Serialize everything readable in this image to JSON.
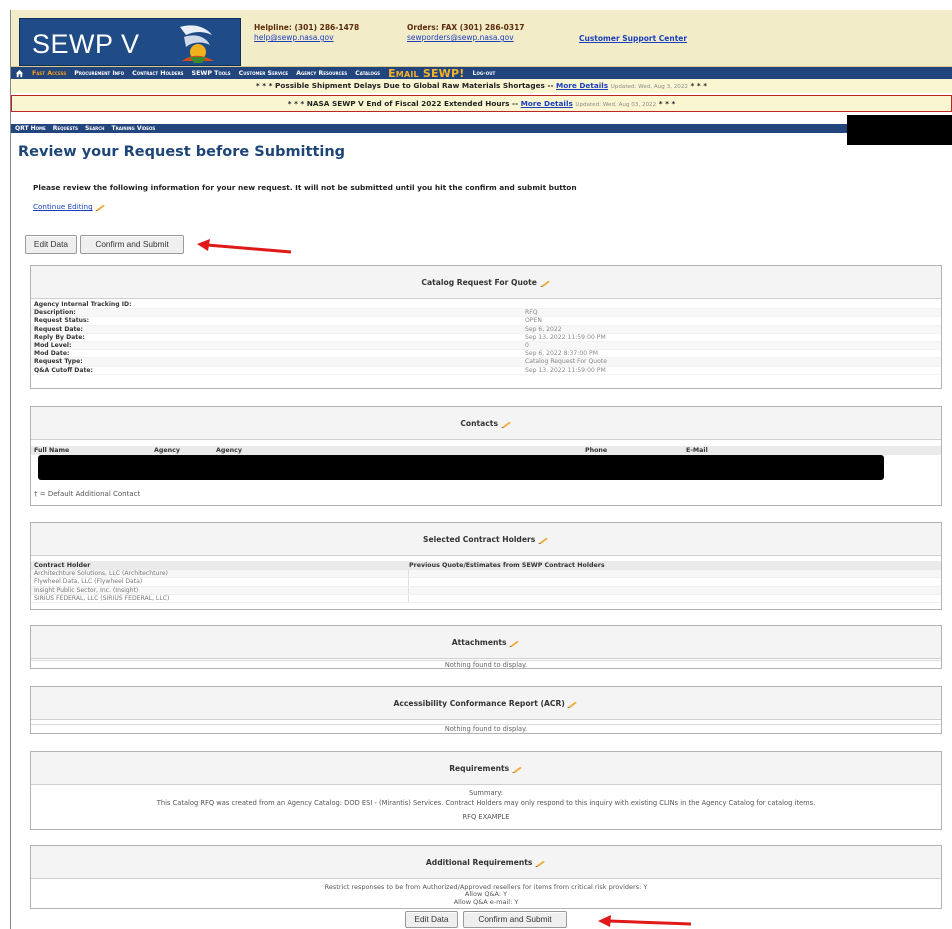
{
  "header": {
    "logo_text": "SEWP V",
    "helpline": "Helpline: (301) 286-1478",
    "help_email": "help@sewp.nasa.gov",
    "orders": "Orders: FAX (301) 286-0317",
    "orders_email": "sewporders@sewp.nasa.gov",
    "customer_support": "Customer Support Center"
  },
  "nav": {
    "items": [
      "Fast Access",
      "Procurement Info",
      "Contract Holders",
      "SEWP Tools",
      "Customer Service",
      "Agency Resources",
      "Catalogs"
    ],
    "email": "Email SEWP!",
    "logout": "Log-out"
  },
  "alerts": [
    {
      "prefix": "* * * Possible Shipment Delays Due to Global Raw Materials Shortages -- ",
      "link": "More Details",
      "updated": "Updated: Wed, Aug 3, 2022",
      "suffix": " * * *"
    },
    {
      "prefix": "* * * NASA SEWP V End of Fiscal 2022 Extended Hours -- ",
      "link": "More Details",
      "updated": "Updated: Wed, Aug 03, 2022",
      "suffix": " * * *"
    }
  ],
  "subnav": {
    "items": [
      "QRT Home",
      "Requests",
      "Search",
      "Training Videos"
    ]
  },
  "page": {
    "title": "Review your Request before Submitting",
    "instructions": "Please review the following information for your new request. It will not be submitted until you hit the confirm and submit button",
    "continue_editing": "Continue Editing",
    "edit_data": "Edit Data",
    "confirm_submit": "Confirm and Submit"
  },
  "rfq": {
    "title": "Catalog Request For Quote",
    "rows": [
      {
        "k": "Agency Internal Tracking ID:",
        "v": ""
      },
      {
        "k": "Description:",
        "v": "RFQ"
      },
      {
        "k": "Request Status:",
        "v": "OPEN"
      },
      {
        "k": "Request Date:",
        "v": "Sep 6, 2022"
      },
      {
        "k": "Reply By Date:",
        "v": "Sep 13, 2022 11:59:00 PM"
      },
      {
        "k": "Mod Level:",
        "v": "0"
      },
      {
        "k": "Mod Date:",
        "v": "Sep 6, 2022 8:37:00 PM"
      },
      {
        "k": "Request Type:",
        "v": "Catalog Request For Quote"
      },
      {
        "k": "Q&A Cutoff Date:",
        "v": "Sep 13, 2022 11:59:00 PM"
      }
    ]
  },
  "contacts": {
    "title": "Contacts",
    "columns": [
      "Full Name",
      "Agency",
      "Agency",
      "Phone",
      "E-Mail"
    ],
    "footnote": "† = Default Additional Contact"
  },
  "contract_holders": {
    "title": "Selected Contract Holders",
    "columns": [
      "Contract Holder",
      "Previous Quote/Estimates from SEWP Contract Holders"
    ],
    "rows": [
      "Architechture Solutions, LLC (Architechture)",
      "Flywheel Data, LLC (Flywheel Data)",
      "Insight Public Sector, Inc. (Insight)",
      "SIRIUS FEDERAL, LLC (SIRIUS FEDERAL, LLC)"
    ]
  },
  "attachments": {
    "title": "Attachments",
    "empty": "Nothing found to display."
  },
  "acr": {
    "title": "Accessibility Conformance Report (ACR)",
    "empty": "Nothing found to display."
  },
  "requirements": {
    "title": "Requirements",
    "summary_label": "Summary:",
    "text": "This Catalog RFQ was created from an Agency Catalog: DOD ESI - (Mirantis) Services. Contract Holders may only respond to this inquiry with existing CLINs in the Agency Catalog for catalog items.",
    "example": "RFQ EXAMPLE"
  },
  "additional_requirements": {
    "title": "Additional Requirements",
    "lines": [
      "Restrict responses to be from Authorized/Approved resellers for items from critical risk providers: Y",
      "Allow Q&A: Y",
      "Allow Q&A e-mail: Y"
    ]
  },
  "colors": {
    "navy": "#23457e",
    "title_blue": "#1e4577",
    "alert_red": "#c02525",
    "annotation_arrow": "#e01818"
  }
}
